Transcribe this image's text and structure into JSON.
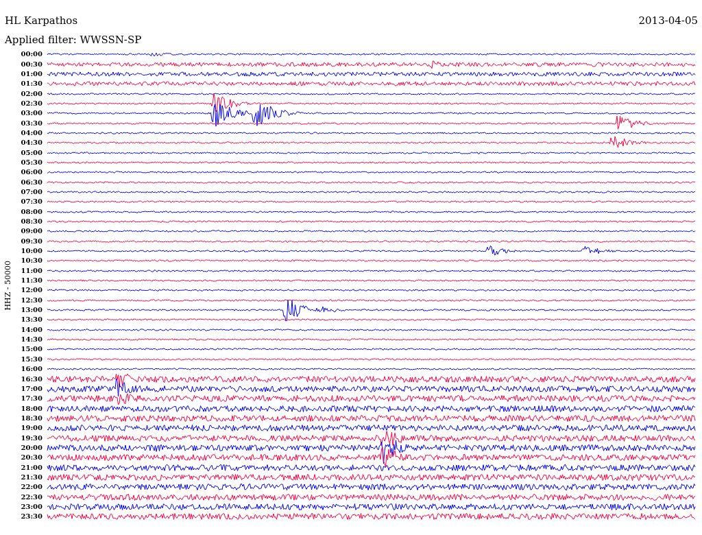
{
  "header": {
    "station": "HL Karpathos",
    "date": "2013-04-05",
    "filter": "Applied filter: WWSSN-SP"
  },
  "axis_label": "HHZ - 50000",
  "rows": [
    {
      "time": "00:00",
      "color": "#0000ff"
    },
    {
      "time": "00:30",
      "color": "#ff0040"
    },
    {
      "time": "01:00",
      "color": "#0000ff"
    },
    {
      "time": "01:30",
      "color": "#ff0040"
    },
    {
      "time": "02:00",
      "color": "#0000ff"
    },
    {
      "time": "02:30",
      "color": "#ff0040"
    },
    {
      "time": "03:00",
      "color": "#0000ff"
    },
    {
      "time": "03:30",
      "color": "#ff0040"
    },
    {
      "time": "04:00",
      "color": "#0000ff"
    },
    {
      "time": "04:30",
      "color": "#ff0040"
    },
    {
      "time": "05:00",
      "color": "#0000ff"
    },
    {
      "time": "05:30",
      "color": "#ff0040"
    },
    {
      "time": "06:00",
      "color": "#0000ff"
    },
    {
      "time": "06:30",
      "color": "#ff0040"
    },
    {
      "time": "07:00",
      "color": "#0000ff"
    },
    {
      "time": "07:30",
      "color": "#ff0040"
    },
    {
      "time": "08:00",
      "color": "#0000ff"
    },
    {
      "time": "08:30",
      "color": "#ff0040"
    },
    {
      "time": "09:00",
      "color": "#0000ff"
    },
    {
      "time": "09:30",
      "color": "#ff0040"
    },
    {
      "time": "10:00",
      "color": "#0000ff"
    },
    {
      "time": "10:30",
      "color": "#ff0040"
    },
    {
      "time": "11:00",
      "color": "#0000ff"
    },
    {
      "time": "11:30",
      "color": "#ff0040"
    },
    {
      "time": "12:00",
      "color": "#0000ff"
    },
    {
      "time": "12:30",
      "color": "#ff0040"
    },
    {
      "time": "13:00",
      "color": "#0000ff"
    },
    {
      "time": "13:30",
      "color": "#ff0040"
    },
    {
      "time": "14:00",
      "color": "#0000ff"
    },
    {
      "time": "14:30",
      "color": "#ff0040"
    },
    {
      "time": "15:00",
      "color": "#0000ff"
    },
    {
      "time": "15:30",
      "color": "#ff0040"
    },
    {
      "time": "16:00",
      "color": "#0000ff"
    },
    {
      "time": "16:30",
      "color": "#ff0040"
    },
    {
      "time": "17:00",
      "color": "#0000ff"
    },
    {
      "time": "17:30",
      "color": "#ff0040"
    },
    {
      "time": "18:00",
      "color": "#0000ff"
    },
    {
      "time": "18:30",
      "color": "#ff0040"
    },
    {
      "time": "19:00",
      "color": "#0000ff"
    },
    {
      "time": "19:30",
      "color": "#ff0040"
    },
    {
      "time": "20:00",
      "color": "#0000ff"
    },
    {
      "time": "20:30",
      "color": "#ff0040"
    },
    {
      "time": "21:00",
      "color": "#0000ff"
    },
    {
      "time": "21:30",
      "color": "#ff0040"
    },
    {
      "time": "22:00",
      "color": "#0000ff"
    },
    {
      "time": "22:30",
      "color": "#ff0040"
    },
    {
      "time": "23:00",
      "color": "#0000ff"
    },
    {
      "time": "23:30",
      "color": "#ff0040"
    }
  ]
}
